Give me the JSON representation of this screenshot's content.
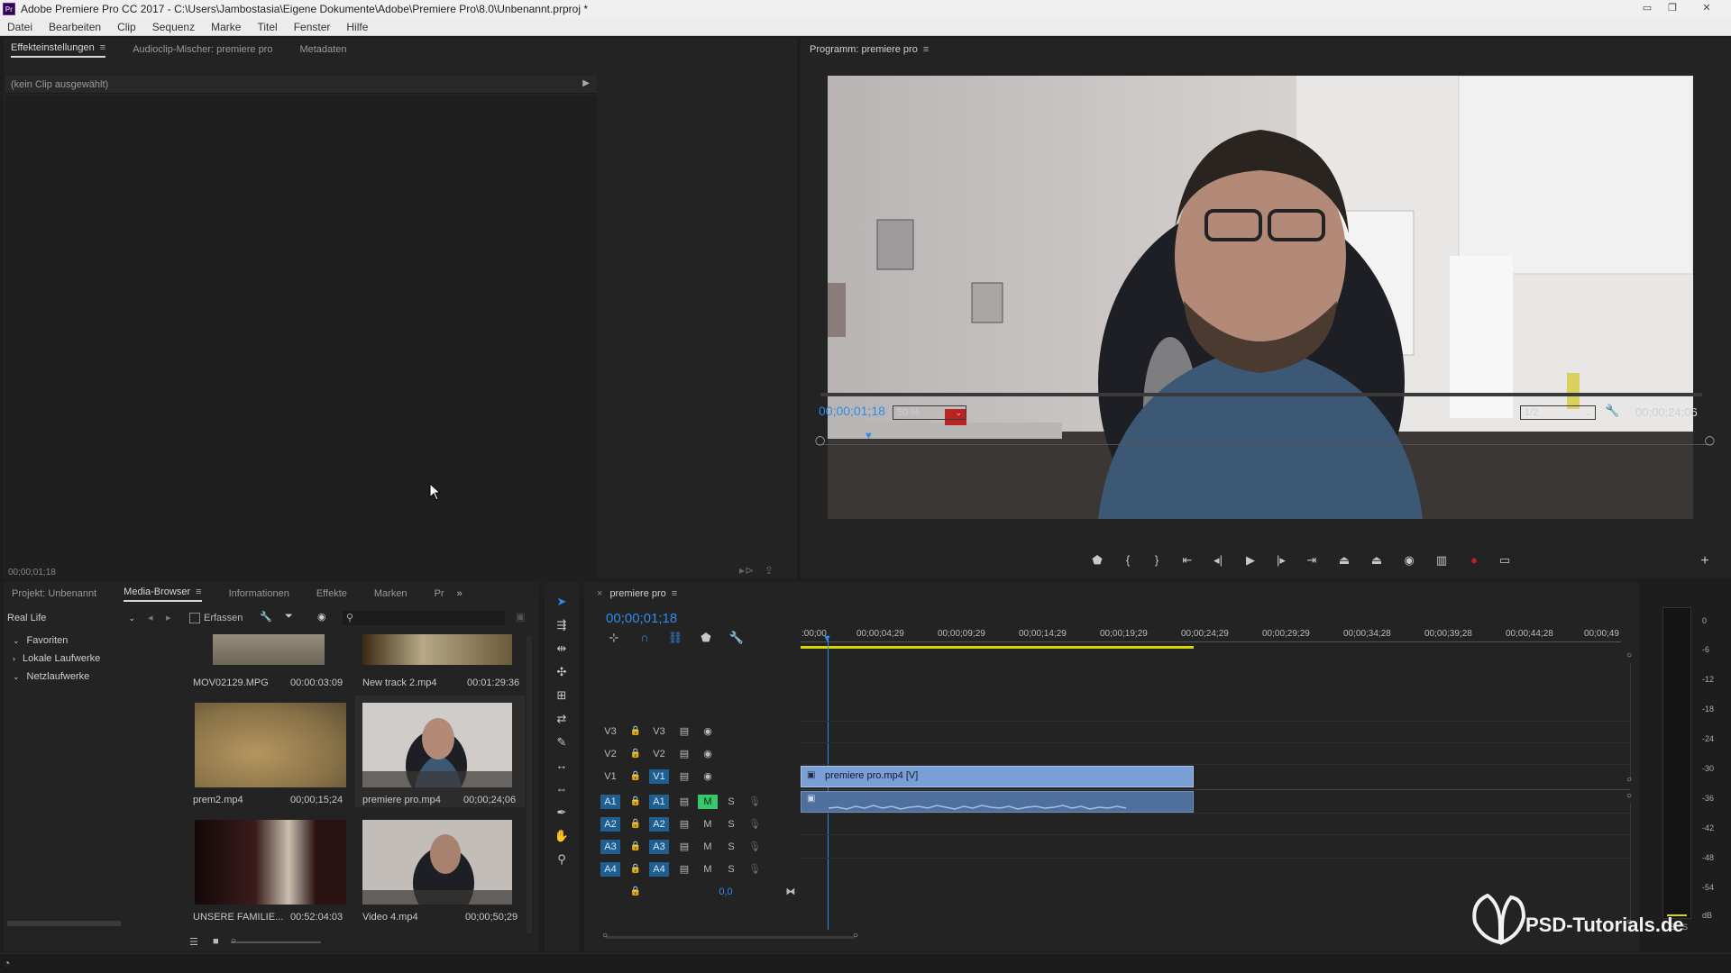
{
  "window": {
    "title": "Adobe Premiere Pro CC 2017 - C:\\Users\\Jambostasia\\Eigene Dokumente\\Adobe\\Premiere Pro\\8.0\\Unbenannt.prproj *",
    "logo": "Pr"
  },
  "menu": [
    "Datei",
    "Bearbeiten",
    "Clip",
    "Sequenz",
    "Marke",
    "Titel",
    "Fenster",
    "Hilfe"
  ],
  "effects_panel": {
    "tabs": [
      "Effekteinstellungen",
      "Audioclip-Mischer: premiere pro",
      "Metadaten"
    ],
    "no_clip": "(kein Clip ausgewählt)",
    "timecode": "00;00;01;18"
  },
  "program_monitor": {
    "title": "Programm: premiere pro",
    "timecode": "00;00;01;18",
    "zoom": "50 %",
    "resolution": "1/2",
    "duration": "00;00;24;06"
  },
  "project_panel": {
    "tabs": [
      "Projekt: Unbenannt",
      "Media-Browser",
      "Informationen",
      "Effekte",
      "Marken",
      "Pr"
    ],
    "location": "Real Life",
    "ingest_label": "Erfassen",
    "tree": [
      "Favoriten",
      "Lokale Laufwerke",
      "Netzlaufwerke"
    ],
    "clips": [
      {
        "name": "MOV02129.MPG",
        "duration": "00:00:03:09"
      },
      {
        "name": "New track 2.mp4",
        "duration": "00:01:29:36"
      },
      {
        "name": "prem2.mp4",
        "duration": "00;00;15;24"
      },
      {
        "name": "premiere pro.mp4",
        "duration": "00;00;24;06"
      },
      {
        "name": "UNSERE FAMILIE...",
        "duration": "00:52:04:03"
      },
      {
        "name": "Video 4.mp4",
        "duration": "00;00;50;29"
      }
    ]
  },
  "timeline": {
    "sequence_name": "premiere pro",
    "timecode": "00;00;01;18",
    "ruler": [
      ":00;00",
      "00;00;04;29",
      "00;00;09;29",
      "00;00;14;29",
      "00;00;19;29",
      "00;00;24;29",
      "00;00;29;29",
      "00;00;34;28",
      "00;00;39;28",
      "00;00;44;28",
      "00;00;49"
    ],
    "video_tracks": [
      {
        "src": "V3",
        "dst": "V3"
      },
      {
        "src": "V2",
        "dst": "V2"
      },
      {
        "src": "V1",
        "dst": "V1"
      }
    ],
    "audio_tracks": [
      {
        "src": "A1",
        "dst": "A1",
        "m": "M",
        "s": "S"
      },
      {
        "src": "A2",
        "dst": "A2",
        "m": "M",
        "s": "S"
      },
      {
        "src": "A3",
        "dst": "A3",
        "m": "M",
        "s": "S"
      },
      {
        "src": "A4",
        "dst": "A4",
        "m": "M",
        "s": "S"
      }
    ],
    "master_value": "0,0",
    "video_clip_label": "premiere pro.mp4 [V]"
  },
  "meter": {
    "labels": [
      "0",
      "-6",
      "-12",
      "-18",
      "-24",
      "-30",
      "-36",
      "-42",
      "-48",
      "-54",
      "dB"
    ],
    "solo_labels": [
      "S",
      "S"
    ]
  },
  "watermark": "PSD-Tutorials.de",
  "colors": {
    "accent_blue": "#2d8ceb",
    "clip_video": "#7a9fd6",
    "clip_audio": "#4f6f9c",
    "playhead": "#2d8ceb",
    "work_area": "#d8d800",
    "mute_active": "#38c76a"
  }
}
